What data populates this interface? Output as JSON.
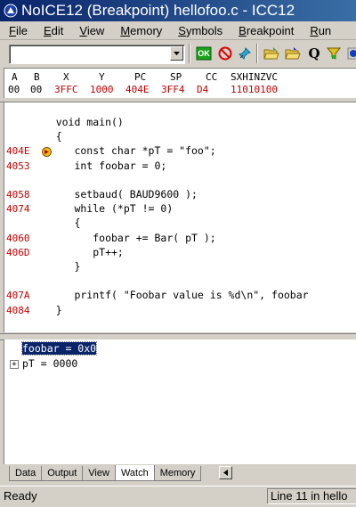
{
  "window": {
    "title": "NoICE12 (Breakpoint) hellofoo.c - ICC12"
  },
  "menu": [
    {
      "label": "File",
      "key": "F",
      "rest": "ile"
    },
    {
      "label": "Edit",
      "key": "E",
      "rest": "dit"
    },
    {
      "label": "View",
      "key": "V",
      "rest": "iew"
    },
    {
      "label": "Memory",
      "key": "M",
      "rest": "emory"
    },
    {
      "label": "Symbols",
      "key": "S",
      "rest": "ymbols"
    },
    {
      "label": "Breakpoint",
      "key": "B",
      "rest": "reakpoint"
    },
    {
      "label": "Run",
      "key": "R",
      "rest": "un"
    }
  ],
  "toolbar": {
    "combo_value": "",
    "buttons": [
      "ok-icon",
      "no-entry-icon",
      "pin-icon",
      "open-folder-icon",
      "open-folder-icon",
      "query-icon",
      "filter-icon",
      "help-icon"
    ],
    "ok_label": "OK",
    "query_label": "Q"
  },
  "registers": {
    "headers": [
      "A",
      "B",
      "X",
      "Y",
      "PC",
      "SP",
      "CC",
      "SXHINZVC"
    ],
    "values": [
      "00",
      "00",
      "3FFC",
      "1000",
      "404E",
      "3FF4",
      "D4",
      "11010100"
    ],
    "changed": [
      false,
      false,
      true,
      true,
      true,
      true,
      true,
      true
    ],
    "changed_color": "#c00000"
  },
  "source": {
    "lines": [
      {
        "addr": "",
        "code": "    void main()"
      },
      {
        "addr": "",
        "code": "    {"
      },
      {
        "addr": "404E",
        "code": "       const char *pT = \"foo\";",
        "breakpoint": true
      },
      {
        "addr": "4053",
        "code": "       int foobar = 0;"
      },
      {
        "addr": "",
        "code": ""
      },
      {
        "addr": "4058",
        "code": "       setbaud( BAUD9600 );"
      },
      {
        "addr": "4074",
        "code": "       while (*pT != 0)"
      },
      {
        "addr": "",
        "code": "       {"
      },
      {
        "addr": "4060",
        "code": "          foobar += Bar( pT );"
      },
      {
        "addr": "406D",
        "code": "          pT++;"
      },
      {
        "addr": "",
        "code": "       }"
      },
      {
        "addr": "",
        "code": ""
      },
      {
        "addr": "407A",
        "code": "       printf( \"Foobar value is %d\\n\", foobar"
      },
      {
        "addr": "4084",
        "code": "    }"
      }
    ]
  },
  "watch": {
    "items": [
      {
        "text": "foobar = 0x0",
        "selected": true,
        "expandable": false
      },
      {
        "text": "pT = 0000",
        "selected": false,
        "expandable": true
      }
    ],
    "expander_glyph": "+"
  },
  "tabs": {
    "items": [
      "Data",
      "Output",
      "View",
      "Watch",
      "Memory"
    ],
    "active": "Watch"
  },
  "status": {
    "left": "Ready",
    "right": "Line 11  in hello"
  }
}
